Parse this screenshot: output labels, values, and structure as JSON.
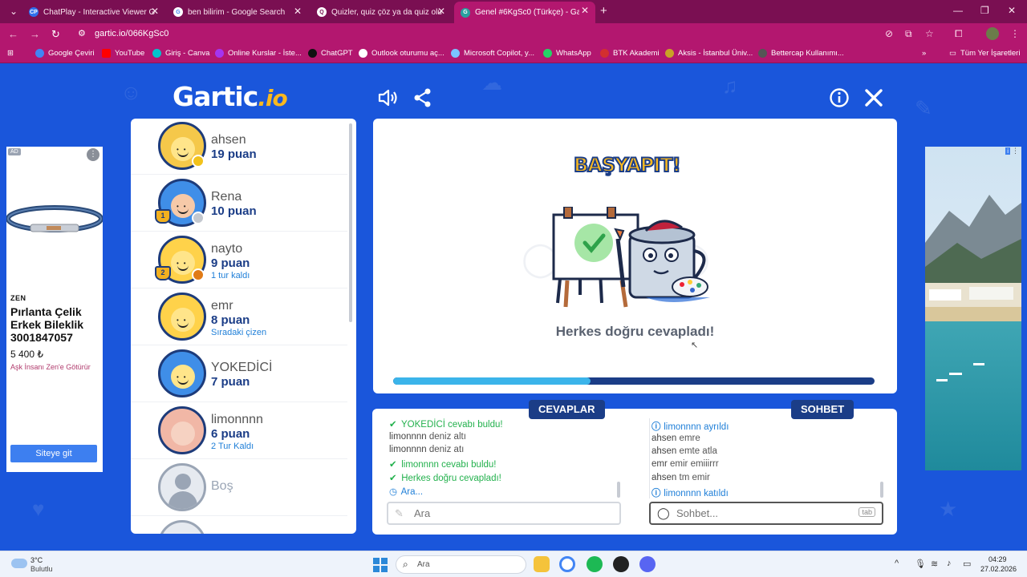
{
  "browser": {
    "tabs": [
      {
        "title": "ChatPlay - Interactive Viewer G",
        "icon": "CP",
        "color": "#2f6fed"
      },
      {
        "title": "ben bilirim - Google Search",
        "icon": "G",
        "color": "#ffffff"
      },
      {
        "title": "Quizler, quiz çöz ya da quiz olu",
        "icon": "Q",
        "color": "#ffffff"
      },
      {
        "title": "Genel #6KgSc0 (Türkçe) - Garti",
        "icon": "G",
        "color": "#2aa0a0"
      }
    ],
    "url": "gartic.io/066KgSc0",
    "bookmarks": [
      {
        "label": "Google Çeviri",
        "color": "#4285f4"
      },
      {
        "label": "YouTube",
        "color": "#ff0000"
      },
      {
        "label": "Giriş - Canva",
        "color": "#00c4cc"
      },
      {
        "label": "Online Kurslar - İste...",
        "color": "#a435f0"
      },
      {
        "label": "ChatGPT",
        "color": "#111111"
      },
      {
        "label": "Outlook oturumu aç...",
        "color": "#ffffff"
      },
      {
        "label": "Microsoft Copilot, y...",
        "color": "#7ac3ff"
      },
      {
        "label": "WhatsApp",
        "color": "#25d366"
      },
      {
        "label": "BTK Akademi",
        "color": "#d32f2f"
      },
      {
        "label": "Aksis - İstanbul Üniv...",
        "color": "#c9a227"
      },
      {
        "label": "Bettercap Kullanımı...",
        "color": "#555555"
      }
    ],
    "all_bookmarks": "Tüm Yer İşaretleri"
  },
  "ad_left": {
    "tag": "AD",
    "brand": "ZEN",
    "title": "Pırlanta Çelik Erkek Bileklik 3001847057",
    "price": "5 400 ₺",
    "slogan": "Aşk İnsanı Zen'e Götürür",
    "button": "Siteye git"
  },
  "players": [
    {
      "name": "ahsen",
      "score": "19 puan",
      "extra": "",
      "dot": "#f2c21b",
      "trophy": ""
    },
    {
      "name": "Rena",
      "score": "10 puan",
      "extra": "",
      "dot": "#c4c8cf",
      "trophy": "1"
    },
    {
      "name": "nayto",
      "score": "9 puan",
      "extra": "1 tur kaldı",
      "dot": "#e07b17",
      "trophy": "2"
    },
    {
      "name": "emr",
      "score": "8 puan",
      "extra": "Sıradaki çizen",
      "dot": "",
      "trophy": ""
    },
    {
      "name": "YOKEDİCİ",
      "score": "7 puan",
      "extra": "",
      "dot": "",
      "trophy": ""
    },
    {
      "name": "limonnnn",
      "score": "6 puan",
      "extra": "2 Tur Kaldı",
      "dot": "",
      "trophy": ""
    },
    {
      "name": "Boş",
      "score": "",
      "extra": "",
      "dot": "",
      "trophy": ""
    }
  ],
  "stage": {
    "banner": "BAŞYAPIT!",
    "message": "Herkes doğru cevapladı!",
    "progress": 0.41
  },
  "answers": {
    "title": "CEVAPLAR",
    "messages": [
      {
        "type": "ok",
        "user": "YOKEDİCİ",
        "text": "cevabı buldu!"
      },
      {
        "type": "normal",
        "user": "limonnnn",
        "text": "deniz altı"
      },
      {
        "type": "normal",
        "user": "limonnnn",
        "text": "deniz atı"
      },
      {
        "type": "ok",
        "user": "limonnnn",
        "text": "cevabı buldu!"
      },
      {
        "type": "ok",
        "user": "",
        "text": "Herkes doğru cevapladı!"
      },
      {
        "type": "sys",
        "user": "",
        "text": "Ara..."
      }
    ],
    "placeholder": "Ara"
  },
  "chat": {
    "title": "SOHBET",
    "messages": [
      {
        "type": "sys",
        "user": "limonnnn",
        "text": "ayrıldı"
      },
      {
        "type": "normal",
        "user": "ahsen",
        "text": "emre"
      },
      {
        "type": "normal",
        "user": "ahsen",
        "text": "emte atla"
      },
      {
        "type": "normal",
        "user": "emr",
        "text": "emir emiiirrr"
      },
      {
        "type": "normal",
        "user": "ahsen",
        "text": "tm emir"
      },
      {
        "type": "sys",
        "user": "limonnnn",
        "text": "katıldı"
      }
    ],
    "placeholder": "Sohbet...",
    "key_hint": "tab"
  },
  "taskbar": {
    "temp": "3°C",
    "weather": "Bulutlu",
    "search": "Ara",
    "time": "04:29",
    "date": "27.02.2026"
  }
}
